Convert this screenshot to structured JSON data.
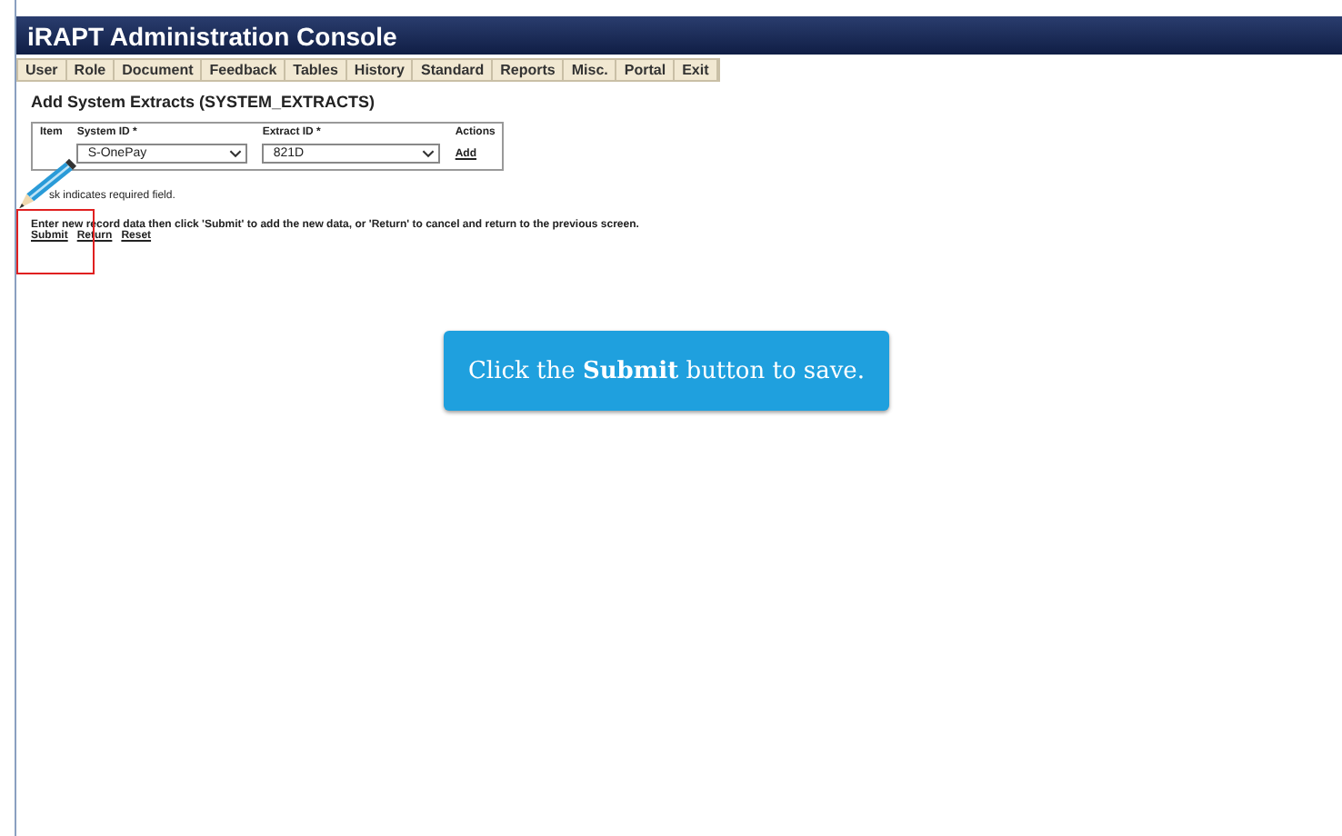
{
  "window": {
    "title": "iRAPT Administration Console"
  },
  "menu": [
    {
      "label": "User"
    },
    {
      "label": "Role"
    },
    {
      "label": "Document"
    },
    {
      "label": "Feedback"
    },
    {
      "label": "Tables"
    },
    {
      "label": "History"
    },
    {
      "label": "Standard"
    },
    {
      "label": "Reports"
    },
    {
      "label": "Misc."
    },
    {
      "label": "Portal"
    },
    {
      "label": "Exit"
    }
  ],
  "page_title": "Add System Extracts (SYSTEM_EXTRACTS)",
  "table": {
    "columns": [
      "Item",
      "System ID *",
      "Extract ID *",
      "Actions"
    ],
    "rows": [
      {
        "item": "",
        "system_id": "S-OnePay",
        "extract_id": "821D",
        "action": "Add"
      }
    ]
  },
  "required_note": "sk indicates required field.",
  "instruction": "Enter new record data then click 'Submit' to add the new data, or 'Return' to cancel and return to the previous screen.",
  "links": [
    "Submit",
    "Return",
    "Reset"
  ],
  "callout": {
    "text": "Click the **Submit** button to save."
  }
}
